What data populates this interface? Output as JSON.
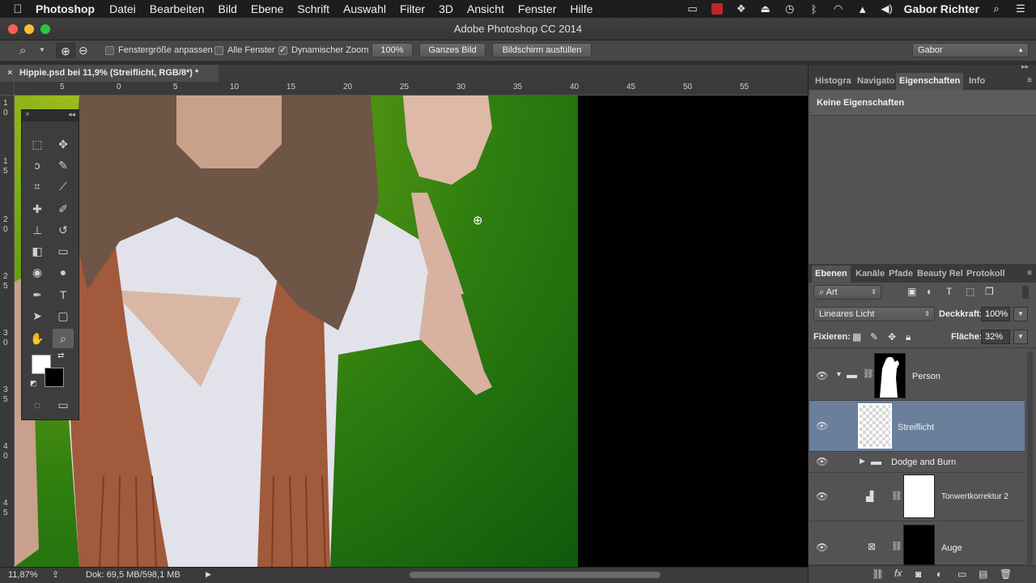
{
  "menubar": {
    "apple": "",
    "app": "Photoshop",
    "items": [
      "Datei",
      "Bearbeiten",
      "Bild",
      "Ebene",
      "Schrift",
      "Auswahl",
      "Filter",
      "3D",
      "Ansicht",
      "Fenster",
      "Hilfe"
    ],
    "user": "Gabor Richter",
    "status_icons": [
      "screen-icon",
      "app-red-icon",
      "dropbox-icon",
      "airplay-icon",
      "time-machine-icon",
      "bluetooth-icon",
      "wifi-icon",
      "eject-icon",
      "volume-icon",
      "search-icon",
      "menu-icon"
    ]
  },
  "window": {
    "title": "Adobe Photoshop CC 2014"
  },
  "options": {
    "fit_label": "Fenstergröße anpassen",
    "all_windows_label": "Alle Fenster",
    "scrubby_label": "Dynamischer Zoom",
    "btn_100": "100%",
    "btn_fit": "Ganzes Bild",
    "btn_fill": "Bildschirm ausfüllen",
    "workspace": "Gabor",
    "fit_checked": false,
    "all_windows_checked": false,
    "scrubby_checked": true
  },
  "document": {
    "tab_title": "Hippie.psd bei 11,9% (Streiflicht, RGB/8*) *"
  },
  "rulers": {
    "h": [
      "5",
      "0",
      "5",
      "10",
      "15",
      "20",
      "25",
      "30",
      "35",
      "40",
      "45",
      "50",
      "55"
    ],
    "v": [
      "1\n0",
      "1\n5",
      "2\n0",
      "2\n5",
      "3\n0",
      "3\n5",
      "4\n0",
      "4\n5"
    ]
  },
  "status": {
    "zoom": "11,87%",
    "doc": "Dok: 69,5 MB/598,1 MB"
  },
  "top_panel": {
    "tabs": [
      "Histogra",
      "Navigato",
      "Eigenschaften",
      "Info"
    ],
    "active_tab": "Eigenschaften",
    "content": "Keine Eigenschaften"
  },
  "layers_panel": {
    "tabs": [
      "Ebenen",
      "Kanäle",
      "Pfade",
      "Beauty Rel",
      "Protokoll"
    ],
    "active_tab": "Ebenen",
    "filter_label": "Art",
    "blend_mode": "Lineares Licht",
    "opacity_label": "Deckkraft:",
    "opacity_value": "100%",
    "lock_label": "Fixieren:",
    "fill_label": "Fläche:",
    "fill_value": "32%",
    "layers": [
      {
        "name": "Person",
        "type": "group-mask"
      },
      {
        "name": "Streiflicht",
        "type": "pixel",
        "selected": true
      },
      {
        "name": "Dodge and Burn",
        "type": "group"
      },
      {
        "name": "Tonwertkorrektur 2",
        "type": "adjustment"
      },
      {
        "name": "Auge",
        "type": "adjustment-mask"
      }
    ]
  }
}
